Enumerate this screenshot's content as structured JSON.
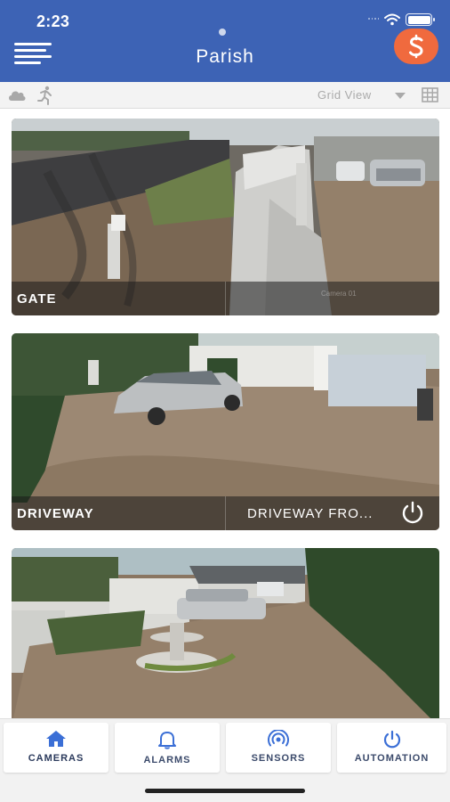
{
  "status_bar": {
    "time": "2:23"
  },
  "header": {
    "title": "Parish"
  },
  "toolbar": {
    "view_label": "Grid View"
  },
  "cameras": [
    {
      "name": "GATE",
      "watermark": "Camera 01"
    },
    {
      "name": "DRIVEWAY",
      "second_label": "DRIVEWAY FRO..."
    },
    {
      "name": ""
    }
  ],
  "bottom_nav": {
    "cameras": "CAMERAS",
    "alarms": "ALARMS",
    "sensors": "SENSORS",
    "automation": "AUTOMATION"
  },
  "colors": {
    "header": "#3d63b5",
    "accent_orange": "#f06a3e",
    "nav_icon": "#3b6fd6"
  },
  "icons": {
    "menu": "menu-icon",
    "profile": "profile-s-icon",
    "cloud": "cloud-icon",
    "motion": "running-person-icon",
    "grid": "grid-icon",
    "power": "power-icon"
  }
}
